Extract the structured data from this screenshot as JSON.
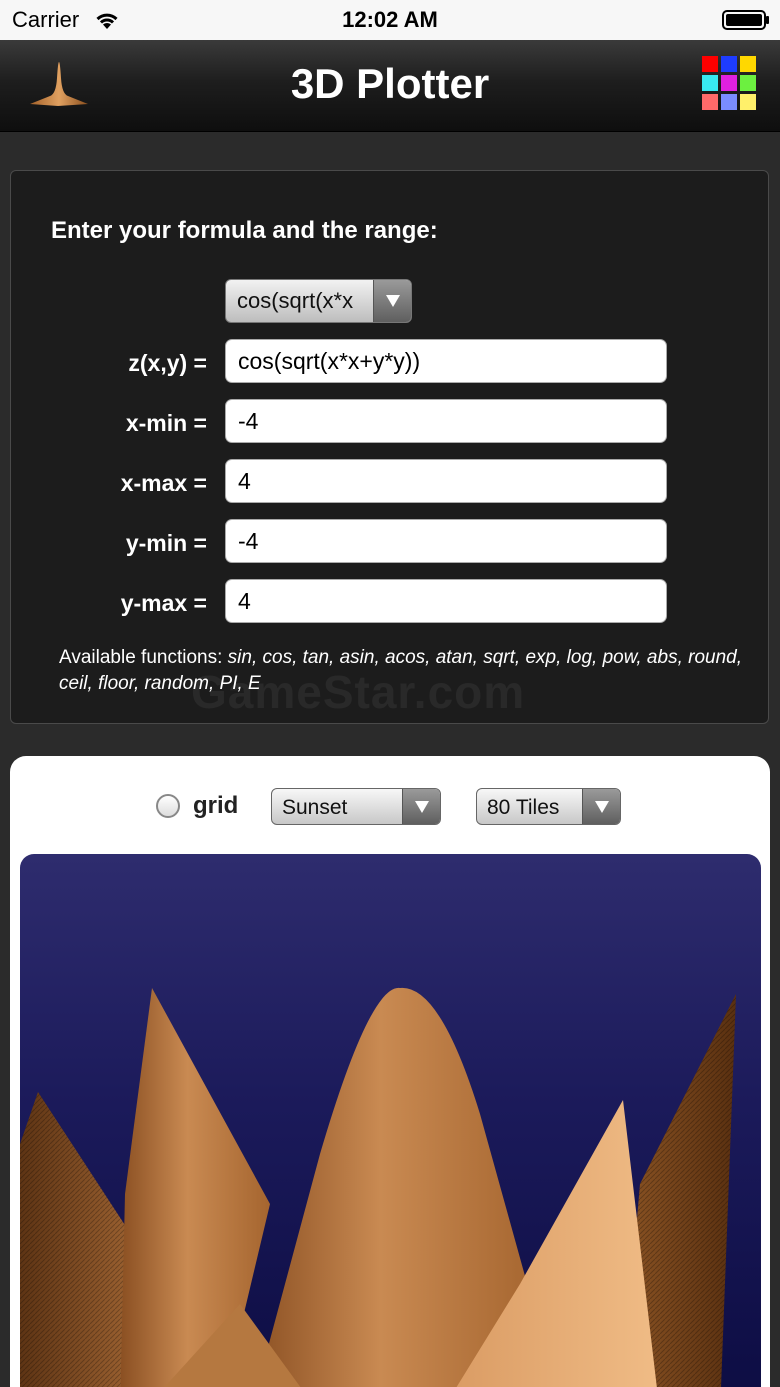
{
  "status": {
    "carrier": "Carrier",
    "time": "12:02 AM"
  },
  "nav": {
    "title": "3D Plotter",
    "logo_icon": "peak-surface-icon",
    "palette_icon": "color-grid-icon",
    "palette_colors": [
      "#ff0000",
      "#1e3cff",
      "#ffd800",
      "#38e8f0",
      "#e020e0",
      "#6cf040",
      "#ff6a6a",
      "#7a8cff",
      "#fff06a"
    ]
  },
  "form": {
    "heading": "Enter your formula and the range:",
    "preset_selected": "cos(sqrt(x*x",
    "fields": [
      {
        "label": "z(x,y) =",
        "value": "cos(sqrt(x*x+y*y))"
      },
      {
        "label": "x-min =",
        "value": "-4"
      },
      {
        "label": "x-max =",
        "value": "4"
      },
      {
        "label": "y-min =",
        "value": "-4"
      },
      {
        "label": "y-max =",
        "value": "4"
      }
    ],
    "functions_prefix": "Available functions: ",
    "functions_list": "sin, cos, tan, asin, acos, atan, sqrt, exp, log, pow, abs, round, ceil, floor, random, PI, E",
    "watermark": "GameStar.com"
  },
  "plot": {
    "grid_label": "grid",
    "grid_checked": false,
    "color_scheme": "Sunset",
    "tiles": "80 Tiles",
    "background_colors": [
      "#2e2c6e",
      "#0c0c42"
    ],
    "surface_colors": [
      "#6e3f1a",
      "#b06e3a",
      "#d99a62",
      "#e8b07a"
    ]
  }
}
